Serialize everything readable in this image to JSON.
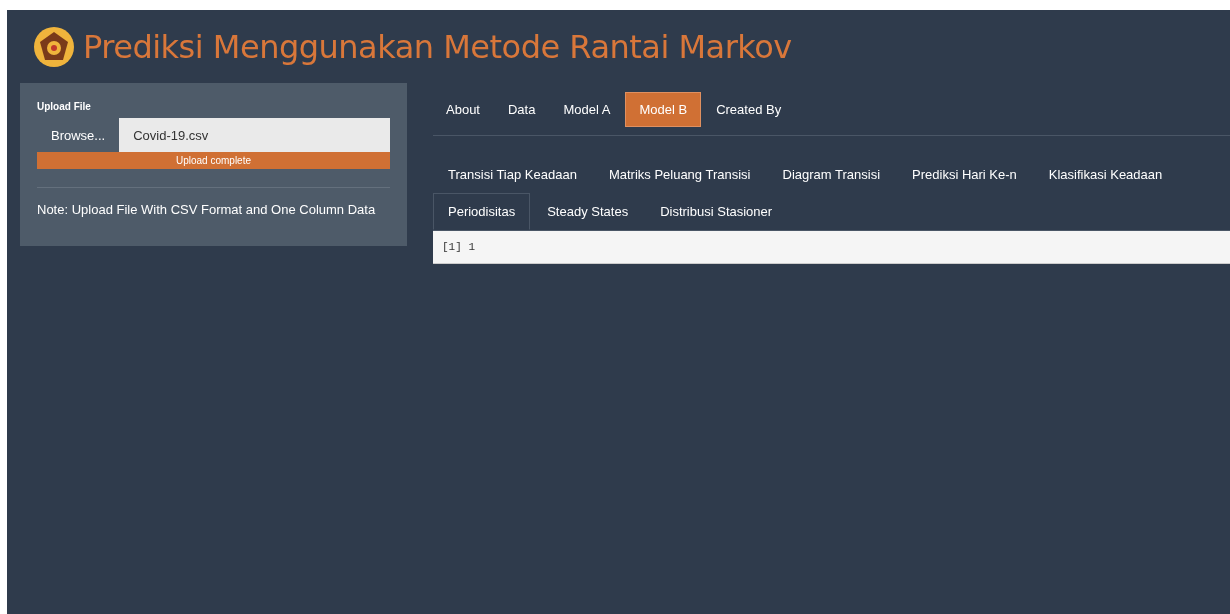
{
  "title": "Prediksi Menggunakan Metode Rantai Markov",
  "sidebar": {
    "upload_label": "Upload File",
    "browse_button": "Browse...",
    "file_name": "Covid-19.csv",
    "progress": {
      "level": 1,
      "text": "Upload complete"
    },
    "note": "Note: Upload File With CSV Format and One Column Data"
  },
  "nav_tabs": [
    {
      "label": "About",
      "selected": false
    },
    {
      "label": "Data",
      "selected": false
    },
    {
      "label": "Model A",
      "selected": false
    },
    {
      "label": "Model B",
      "selected": true
    },
    {
      "label": "Created By",
      "selected": false
    }
  ],
  "sub_tabs": [
    {
      "label": "Transisi Tiap Keadaan",
      "selected": false
    },
    {
      "label": "Matriks Peluang Transisi",
      "selected": false
    },
    {
      "label": "Diagram Transisi",
      "selected": false
    },
    {
      "label": "Prediksi Hari Ke-n",
      "selected": false
    },
    {
      "label": "Klasifikasi Keadaan",
      "selected": false
    },
    {
      "label": "Periodisitas",
      "selected": true
    },
    {
      "label": "Steady States",
      "selected": false
    },
    {
      "label": "Distribusi Stasioner",
      "selected": false
    }
  ],
  "output": "[1] 1"
}
